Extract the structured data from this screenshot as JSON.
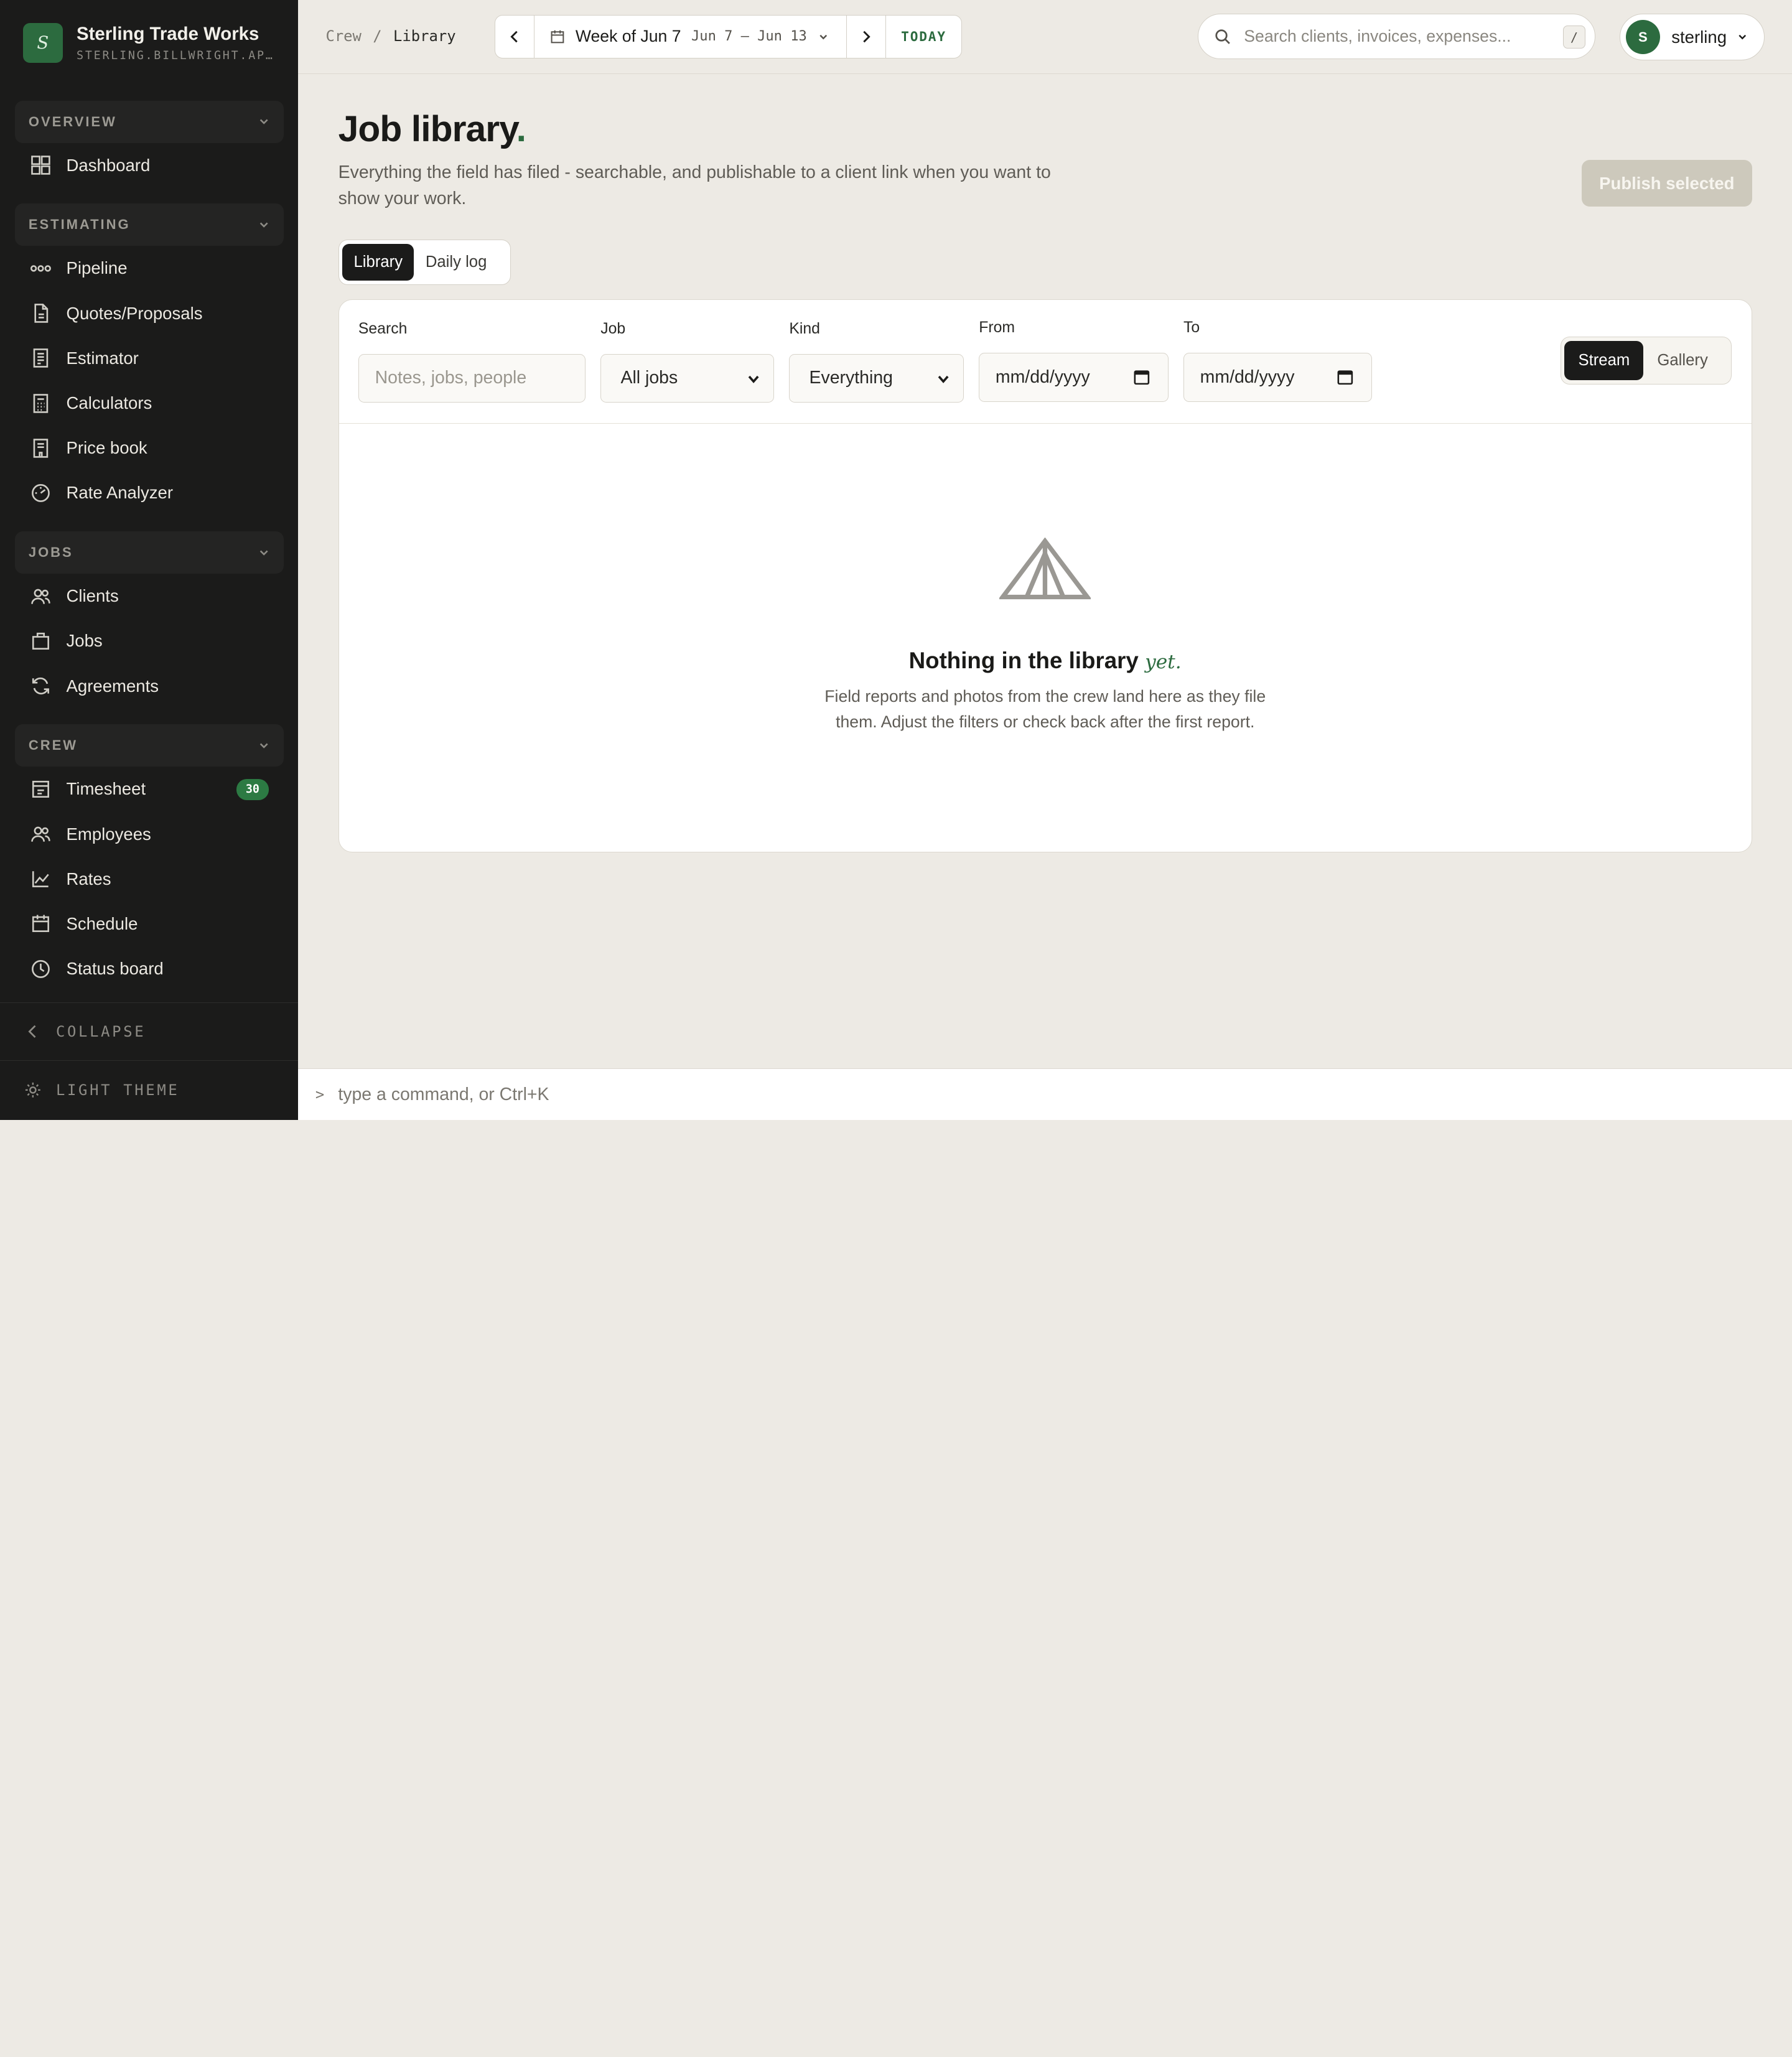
{
  "brand": {
    "initial": "S",
    "name": "Sterling Trade Works",
    "domain": "STERLING.BILLWRIGHT.APP"
  },
  "sidebar": {
    "sections": [
      {
        "label": "OVERVIEW",
        "items": [
          {
            "label": "Dashboard",
            "icon": "grid-icon"
          }
        ]
      },
      {
        "label": "ESTIMATING",
        "items": [
          {
            "label": "Pipeline",
            "icon": "pipeline-icon"
          },
          {
            "label": "Quotes/Proposals",
            "icon": "document-icon"
          },
          {
            "label": "Estimator",
            "icon": "clipboard-icon"
          },
          {
            "label": "Calculators",
            "icon": "calculator-icon"
          },
          {
            "label": "Price book",
            "icon": "book-icon"
          },
          {
            "label": "Rate Analyzer",
            "icon": "gauge-icon"
          }
        ]
      },
      {
        "label": "JOBS",
        "items": [
          {
            "label": "Clients",
            "icon": "users-icon"
          },
          {
            "label": "Jobs",
            "icon": "briefcase-icon"
          },
          {
            "label": "Agreements",
            "icon": "refresh-icon"
          }
        ]
      },
      {
        "label": "CREW",
        "items": [
          {
            "label": "Timesheet",
            "icon": "timesheet-icon",
            "badge": "30"
          },
          {
            "label": "Employees",
            "icon": "users-icon"
          },
          {
            "label": "Rates",
            "icon": "chart-line-icon"
          },
          {
            "label": "Schedule",
            "icon": "calendar-icon"
          },
          {
            "label": "Status board",
            "icon": "clock-icon"
          }
        ]
      }
    ],
    "collapse_label": "COLLAPSE",
    "theme_label": "LIGHT THEME"
  },
  "topbar": {
    "breadcrumb": [
      "Crew",
      "/",
      "Library"
    ],
    "week_title": "Week of Jun 7",
    "week_range": "Jun 7 – Jun 13",
    "today_label": "TODAY",
    "search_placeholder": "Search clients, invoices, expenses...",
    "search_shortcut": "/",
    "user_initial": "S",
    "user_name": "sterling"
  },
  "page": {
    "title": "Job library",
    "title_dot": ".",
    "subtitle": "Everything the field has filed - searchable, and publishable to a client link when you want to show your work.",
    "publish_label": "Publish selected",
    "tabs": [
      {
        "label": "Library",
        "active": true
      },
      {
        "label": "Daily log",
        "active": false
      }
    ]
  },
  "filters": {
    "search_label": "Search",
    "search_placeholder": "Notes, jobs, people",
    "job_label": "Job",
    "job_value": "All jobs",
    "kind_label": "Kind",
    "kind_value": "Everything",
    "from_label": "From",
    "from_placeholder": "mm/dd/yyyy",
    "to_label": "To",
    "to_placeholder": "mm/dd/yyyy",
    "view_options": [
      {
        "label": "Stream",
        "active": true
      },
      {
        "label": "Gallery",
        "active": false
      }
    ]
  },
  "empty": {
    "title": "Nothing in the library",
    "title_accent": "yet.",
    "description": "Field reports and photos from the crew land here as they file them. Adjust the filters or check back after the first report."
  },
  "command": {
    "prompt": ">",
    "placeholder": "type a command, or Ctrl+K"
  },
  "colors": {
    "accent": "#2c6b3f",
    "sidebar_bg": "#1b1b1a",
    "page_bg": "#edeae4"
  }
}
